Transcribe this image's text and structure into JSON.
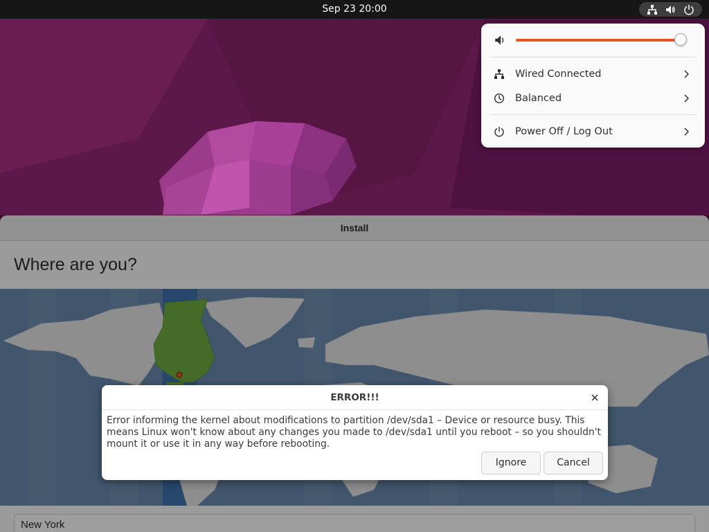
{
  "topbar": {
    "clock": "Sep 23  20:00",
    "status_icons": [
      "network-wired-icon",
      "volume-icon",
      "power-icon"
    ]
  },
  "quick_settings": {
    "volume_level_fraction": 0.97,
    "items": [
      {
        "label": "Wired Connected",
        "icon": "network-wired-icon"
      },
      {
        "label": "Balanced",
        "icon": "power-profile-icon"
      },
      {
        "label": "Power Off / Log Out",
        "icon": "power-icon"
      }
    ],
    "accent": "#e95420"
  },
  "installer": {
    "window_title": "Install",
    "page_title": "Where are you?",
    "selected_city": "New York"
  },
  "error_dialog": {
    "title": "ERROR!!!",
    "message": "Error informing the kernel about modifications to partition /dev/sda1 – Device or resource busy. This means Linux won't know about any changes you made to /dev/sda1 until you reboot – so you shouldn't mount it or use it in any way before rebooting.",
    "buttons": {
      "ignore": "Ignore",
      "cancel": "Cancel"
    }
  }
}
